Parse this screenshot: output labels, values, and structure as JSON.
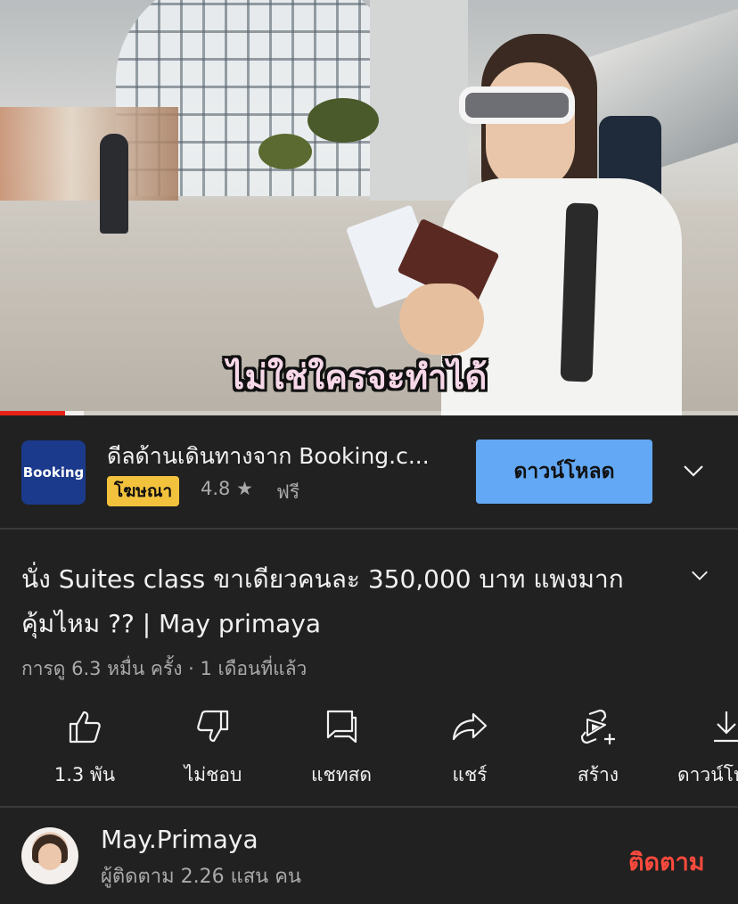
{
  "video": {
    "subtitle": "ไม่ใช่ใครจะทำได้",
    "progress": 0.088,
    "buffered": 0.113
  },
  "ad": {
    "logo_text": "Booking",
    "title": "ดีลด้านเดินทางจาก Booking.c...",
    "badge": "โฆษณา",
    "rating": "4.8 ★",
    "price": "ฟรี",
    "download_label": "ดาวน์โหลด",
    "expand_icon": "chevron-down-icon"
  },
  "video_info": {
    "title": "นั่ง Suites class ขาเดียวคนละ 350,000 บาท แพงมาก คุ้มไหม ?? | May primaya",
    "meta": "การดู 6.3 หมื่น ครั้ง · 1 เดือนที่แล้ว"
  },
  "actions": [
    {
      "icon": "like-icon",
      "label": "1.3 พัน"
    },
    {
      "icon": "dislike-icon",
      "label": "ไม่ชอบ"
    },
    {
      "icon": "live-chat-icon",
      "label": "แชทสด"
    },
    {
      "icon": "share-icon",
      "label": "แชร์"
    },
    {
      "icon": "remix-icon",
      "label": "สร้าง"
    },
    {
      "icon": "download-icon",
      "label": "ดาวน์โห"
    }
  ],
  "channel": {
    "name": "May.Primaya",
    "subscribers": "ผู้ติดตาม 2.26 แสน คน",
    "subscribe_label": "ติดตาม"
  },
  "colors": {
    "background": "#212121",
    "progress": "#e62117",
    "download_button": "#62a8f4",
    "ad_badge": "#f3c23d",
    "subscribe": "#ff4a3d"
  }
}
